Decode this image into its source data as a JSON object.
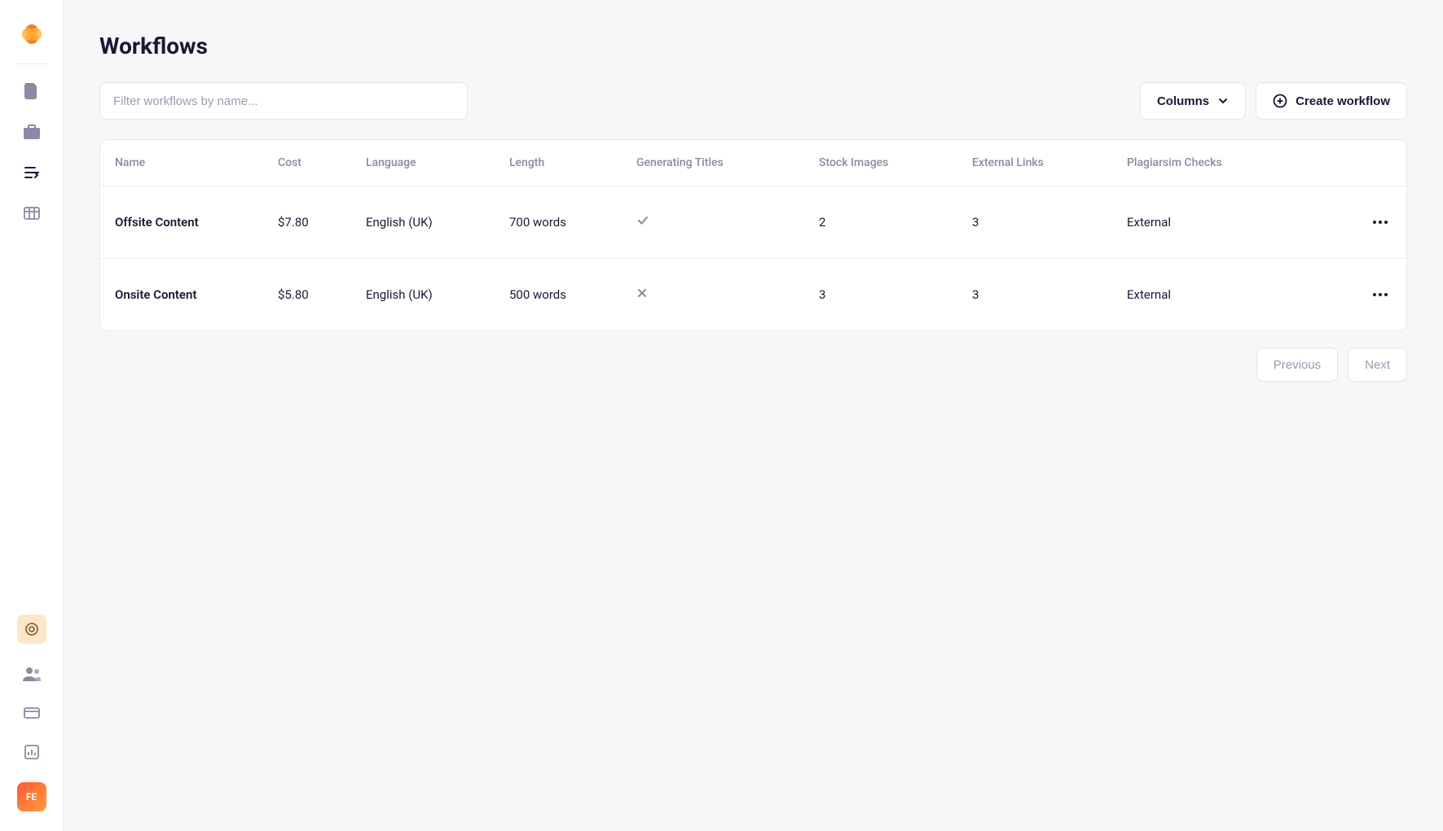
{
  "page": {
    "title": "Workflows"
  },
  "search": {
    "placeholder": "Filter workflows by name..."
  },
  "toolbar": {
    "columns_label": "Columns",
    "create_label": "Create workflow"
  },
  "avatar": {
    "initials": "FE"
  },
  "table": {
    "headers": {
      "name": "Name",
      "cost": "Cost",
      "language": "Language",
      "length": "Length",
      "gen_titles": "Generating Titles",
      "stock_images": "Stock Images",
      "external_links": "External Links",
      "plagiarism": "Plagiarsim Checks"
    },
    "rows": [
      {
        "name": "Offsite Content",
        "cost": "$7.80",
        "language": "English (UK)",
        "length": "700 words",
        "gen_titles": true,
        "stock_images": "2",
        "external_links": "3",
        "plagiarism": "External"
      },
      {
        "name": "Onsite Content",
        "cost": "$5.80",
        "language": "English (UK)",
        "length": "500 words",
        "gen_titles": false,
        "stock_images": "3",
        "external_links": "3",
        "plagiarism": "External"
      }
    ]
  },
  "pagination": {
    "previous": "Previous",
    "next": "Next"
  }
}
